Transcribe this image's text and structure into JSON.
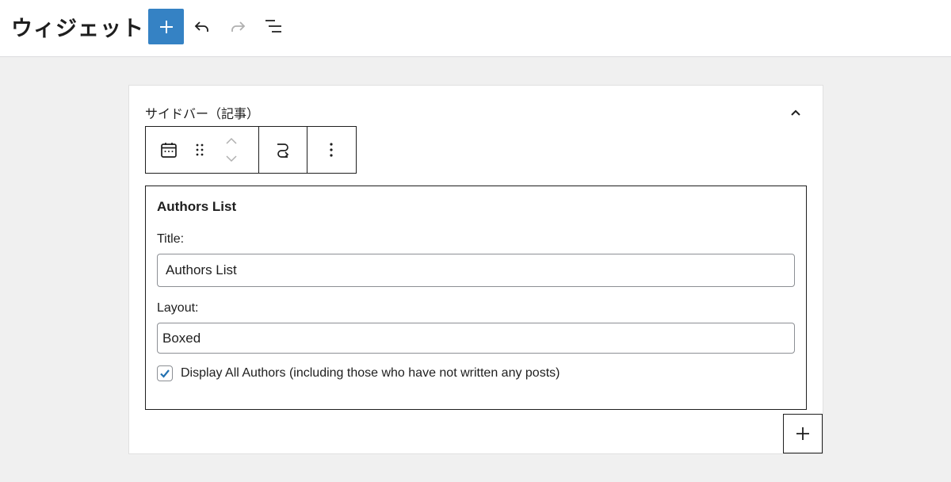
{
  "header": {
    "title": "ウィジェット",
    "buttons": {
      "add": "block-inserter",
      "undo": "undo",
      "redo": "redo",
      "list_view": "list-view"
    }
  },
  "widget_area": {
    "title": "サイドバー（記事）",
    "collapse_icon": "chevron-up-icon"
  },
  "block_toolbar": {
    "icons": [
      "calendar-icon",
      "drag-handle-icon",
      "move-up-icon",
      "move-down-icon",
      "transform-icon",
      "more-options-icon"
    ]
  },
  "widget": {
    "heading": "Authors List",
    "title_label": "Title:",
    "title_value": "Authors List",
    "layout_label": "Layout:",
    "layout_value": "Boxed",
    "display_all_label": "Display All Authors (including those who have not written any posts)",
    "display_all_checked": true
  },
  "colors": {
    "accent": "#3582c4",
    "checkmark": "#2271b1",
    "background": "#f0f0f0"
  }
}
